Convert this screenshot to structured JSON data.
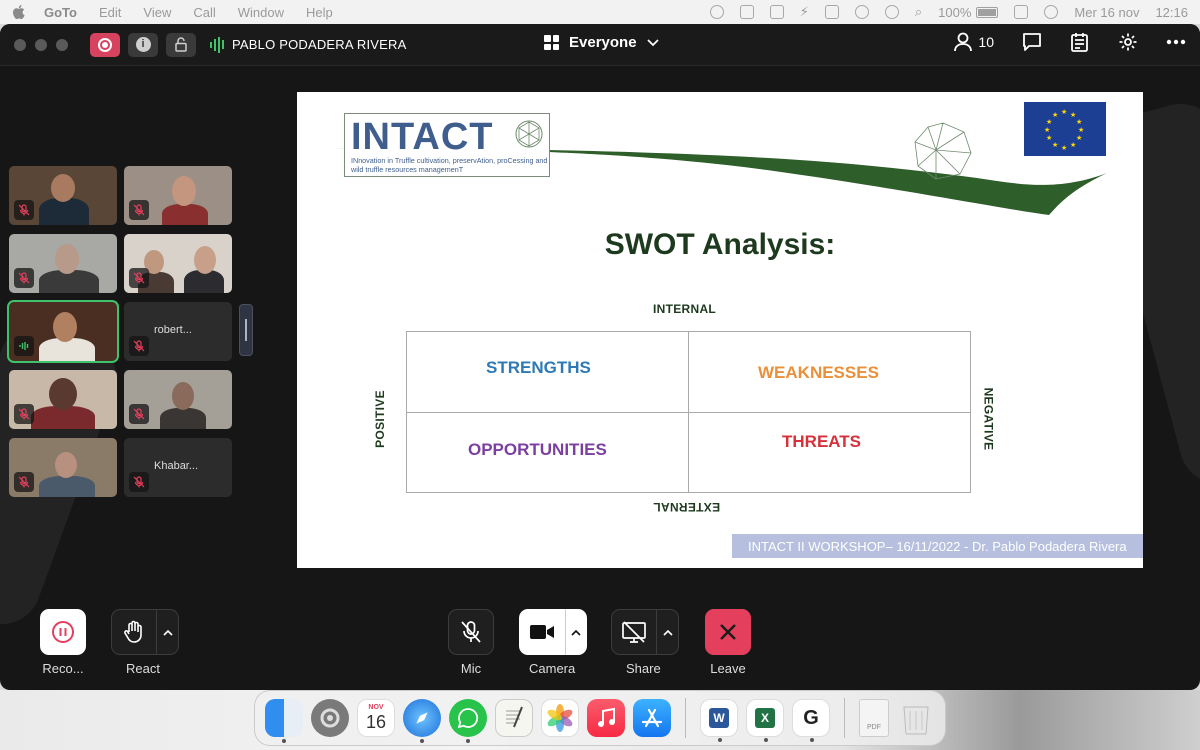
{
  "menubar": {
    "app_name": "GoTo",
    "items": [
      "Edit",
      "View",
      "Call",
      "Window",
      "Help"
    ],
    "battery": "100%",
    "date": "Mer 16 nov",
    "time": "12:16"
  },
  "titlebar": {
    "active_speaker": "PABLO PODADERA RIVERA",
    "audience": "Everyone",
    "participant_count": "10"
  },
  "tiles": [
    {
      "name": "",
      "muted": true
    },
    {
      "name": "",
      "muted": true
    },
    {
      "name": "",
      "muted": true
    },
    {
      "name": "",
      "muted": true
    },
    {
      "name": "",
      "muted": false,
      "speaking": true
    },
    {
      "name": "robert...",
      "muted": true
    },
    {
      "name": "",
      "muted": true
    },
    {
      "name": "",
      "muted": true
    },
    {
      "name": "",
      "muted": true
    },
    {
      "name": "Khabar...",
      "muted": true
    }
  ],
  "slide": {
    "logo_word": "INTACT",
    "logo_subtitle": "INnovation in Truffle cultivation, preservAtion, proCessing and wild truffle resources managemenT",
    "title": "SWOT Analysis:",
    "axis_internal": "INTERNAL",
    "axis_external": "EXTERNAL",
    "axis_positive": "POSITIVE",
    "axis_negative": "NEGATIVE",
    "strengths": "STRENGTHS",
    "weaknesses": "WEAKNESSES",
    "opportunities": "OPPORTUNITIES",
    "threats": "THREATS",
    "footer": "INTACT II WORKSHOP– 16/11/2022 - Dr. Pablo Podadera Rivera",
    "colors": {
      "strengths": "#2e7ab5",
      "weaknesses": "#e8913a",
      "opportunities": "#7b3fa0",
      "threats": "#d6303a"
    }
  },
  "controls": {
    "record": "Reco...",
    "react": "React",
    "mic": "Mic",
    "camera": "Camera",
    "share": "Share",
    "leave": "Leave"
  },
  "dock": {
    "calendar_month": "NOV",
    "calendar_day": "16"
  }
}
